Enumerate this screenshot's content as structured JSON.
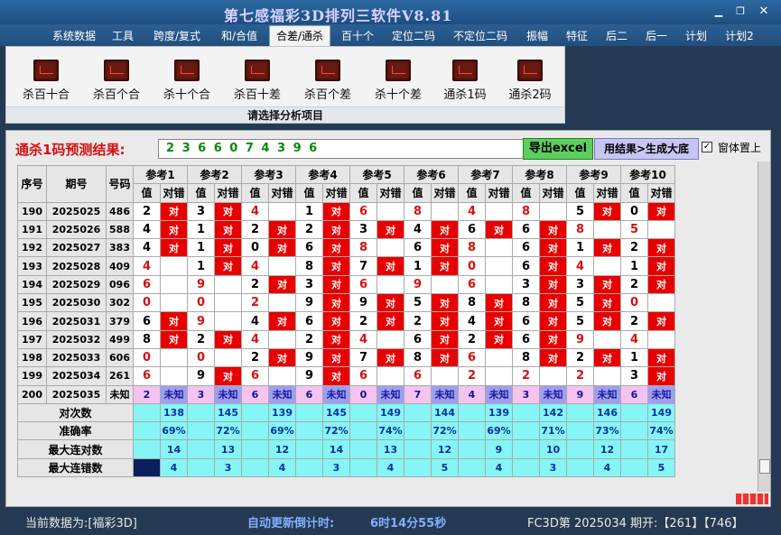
{
  "window": {
    "title": "第七感福彩3D排列三软件V8.81"
  },
  "menu": [
    "系统数据",
    "工具",
    "跨度/复式",
    "和/合值",
    "合差/通杀",
    "百十个",
    "定位二码",
    "不定位二码",
    "振幅",
    "特征",
    "后二",
    "后一",
    "计划",
    "计划2"
  ],
  "ribbon": {
    "items": [
      "杀百十合",
      "杀百个合",
      "杀十个合",
      "杀百十差",
      "杀百个差",
      "杀十个差",
      "通杀1码",
      "通杀2码"
    ],
    "caption": "请选择分析项目"
  },
  "prediction": {
    "label": "通杀1码预测结果:",
    "value": "2 3 6 6 0 7 4 3 9 6"
  },
  "buttons": {
    "export": "导出excel",
    "generate": "用结果>生成大底",
    "stay_on_top": "窗体置上"
  },
  "table": {
    "headers": {
      "seq": "序号",
      "period": "期号",
      "number": "号码",
      "val": "值",
      "ok": "对错"
    },
    "refs": [
      "参考1",
      "参考2",
      "参考3",
      "参考4",
      "参考5",
      "参考6",
      "参考7",
      "参考8",
      "参考9",
      "参考10"
    ],
    "rows": [
      {
        "seq": "190",
        "period": "2025025",
        "number": "486",
        "cells": [
          [
            "2",
            1
          ],
          [
            "3",
            1
          ],
          [
            "4",
            0
          ],
          [
            "1",
            1
          ],
          [
            "6",
            0
          ],
          [
            "8",
            0
          ],
          [
            "4",
            0
          ],
          [
            "8",
            0
          ],
          [
            "5",
            1
          ],
          [
            "0",
            1
          ]
        ]
      },
      {
        "seq": "191",
        "period": "2025026",
        "number": "588",
        "cells": [
          [
            "4",
            1
          ],
          [
            "1",
            1
          ],
          [
            "2",
            1
          ],
          [
            "2",
            1
          ],
          [
            "3",
            1
          ],
          [
            "4",
            1
          ],
          [
            "6",
            1
          ],
          [
            "6",
            1
          ],
          [
            "8",
            0
          ],
          [
            "5",
            0
          ]
        ]
      },
      {
        "seq": "192",
        "period": "2025027",
        "number": "383",
        "cells": [
          [
            "4",
            1
          ],
          [
            "1",
            1
          ],
          [
            "0",
            1
          ],
          [
            "6",
            1
          ],
          [
            "8",
            0
          ],
          [
            "6",
            1
          ],
          [
            "8",
            0
          ],
          [
            "6",
            1
          ],
          [
            "1",
            1
          ],
          [
            "2",
            1
          ]
        ]
      },
      {
        "seq": "193",
        "period": "2025028",
        "number": "409",
        "cells": [
          [
            "4",
            0
          ],
          [
            "1",
            1
          ],
          [
            "4",
            0
          ],
          [
            "8",
            1
          ],
          [
            "7",
            1
          ],
          [
            "1",
            1
          ],
          [
            "0",
            0
          ],
          [
            "6",
            1
          ],
          [
            "4",
            0
          ],
          [
            "1",
            1
          ]
        ]
      },
      {
        "seq": "194",
        "period": "2025029",
        "number": "096",
        "cells": [
          [
            "6",
            0
          ],
          [
            "9",
            0
          ],
          [
            "2",
            1
          ],
          [
            "3",
            1
          ],
          [
            "6",
            0
          ],
          [
            "9",
            0
          ],
          [
            "6",
            0
          ],
          [
            "3",
            1
          ],
          [
            "3",
            1
          ],
          [
            "2",
            1
          ]
        ]
      },
      {
        "seq": "195",
        "period": "2025030",
        "number": "302",
        "cells": [
          [
            "0",
            0
          ],
          [
            "0",
            0
          ],
          [
            "2",
            0
          ],
          [
            "9",
            1
          ],
          [
            "9",
            1
          ],
          [
            "5",
            1
          ],
          [
            "8",
            1
          ],
          [
            "8",
            1
          ],
          [
            "5",
            1
          ],
          [
            "0",
            0
          ]
        ]
      },
      {
        "seq": "196",
        "period": "2025031",
        "number": "379",
        "cells": [
          [
            "6",
            1
          ],
          [
            "9",
            0
          ],
          [
            "4",
            1
          ],
          [
            "6",
            1
          ],
          [
            "2",
            1
          ],
          [
            "2",
            1
          ],
          [
            "4",
            1
          ],
          [
            "6",
            1
          ],
          [
            "5",
            1
          ],
          [
            "2",
            1
          ]
        ]
      },
      {
        "seq": "197",
        "period": "2025032",
        "number": "499",
        "cells": [
          [
            "8",
            1
          ],
          [
            "2",
            1
          ],
          [
            "4",
            0
          ],
          [
            "2",
            1
          ],
          [
            "4",
            0
          ],
          [
            "6",
            1
          ],
          [
            "2",
            1
          ],
          [
            "6",
            1
          ],
          [
            "9",
            0
          ],
          [
            "4",
            0
          ]
        ]
      },
      {
        "seq": "198",
        "period": "2025033",
        "number": "606",
        "cells": [
          [
            "0",
            0
          ],
          [
            "0",
            0
          ],
          [
            "2",
            1
          ],
          [
            "9",
            1
          ],
          [
            "7",
            1
          ],
          [
            "8",
            1
          ],
          [
            "6",
            0
          ],
          [
            "8",
            1
          ],
          [
            "2",
            1
          ],
          [
            "1",
            1
          ]
        ]
      },
      {
        "seq": "199",
        "period": "2025034",
        "number": "261",
        "cells": [
          [
            "6",
            0
          ],
          [
            "9",
            1
          ],
          [
            "6",
            0
          ],
          [
            "9",
            1
          ],
          [
            "6",
            0
          ],
          [
            "6",
            0
          ],
          [
            "2",
            0
          ],
          [
            "2",
            0
          ],
          [
            "2",
            0
          ],
          [
            "3",
            1
          ]
        ]
      }
    ],
    "unknown_row": {
      "seq": "200",
      "period": "2025035",
      "number": "未知",
      "values": [
        "2",
        "3",
        "6",
        "6",
        "0",
        "7",
        "4",
        "3",
        "9",
        "6"
      ],
      "ok_label": "未知"
    },
    "hit_label": "对",
    "stats": [
      {
        "label": "对次数",
        "values": [
          "138",
          "145",
          "139",
          "145",
          "149",
          "144",
          "139",
          "142",
          "146",
          "149"
        ]
      },
      {
        "label": "准确率",
        "values": [
          "69%",
          "72%",
          "69%",
          "72%",
          "74%",
          "72%",
          "69%",
          "71%",
          "73%",
          "74%"
        ]
      },
      {
        "label": "最大连对数",
        "values": [
          "14",
          "13",
          "12",
          "14",
          "13",
          "12",
          "9",
          "10",
          "12",
          "17"
        ]
      },
      {
        "label": "最大连错数",
        "values": [
          "4",
          "3",
          "4",
          "3",
          "4",
          "5",
          "4",
          "3",
          "4",
          "5"
        ]
      }
    ]
  },
  "statusbar": {
    "data_source": "当前数据为:[福彩3D]",
    "countdown_label": "自动更新倒计时:",
    "countdown": "6时14分55秒",
    "draw_info": "FC3D第 2025034 期开:【261】【746】"
  },
  "colors": {
    "hit": "#e80000",
    "unknown_value": "#f4c3ef",
    "unknown_ok": "#9f9ff0",
    "stats": "#85f5f5",
    "title": "#d8d2ff"
  }
}
